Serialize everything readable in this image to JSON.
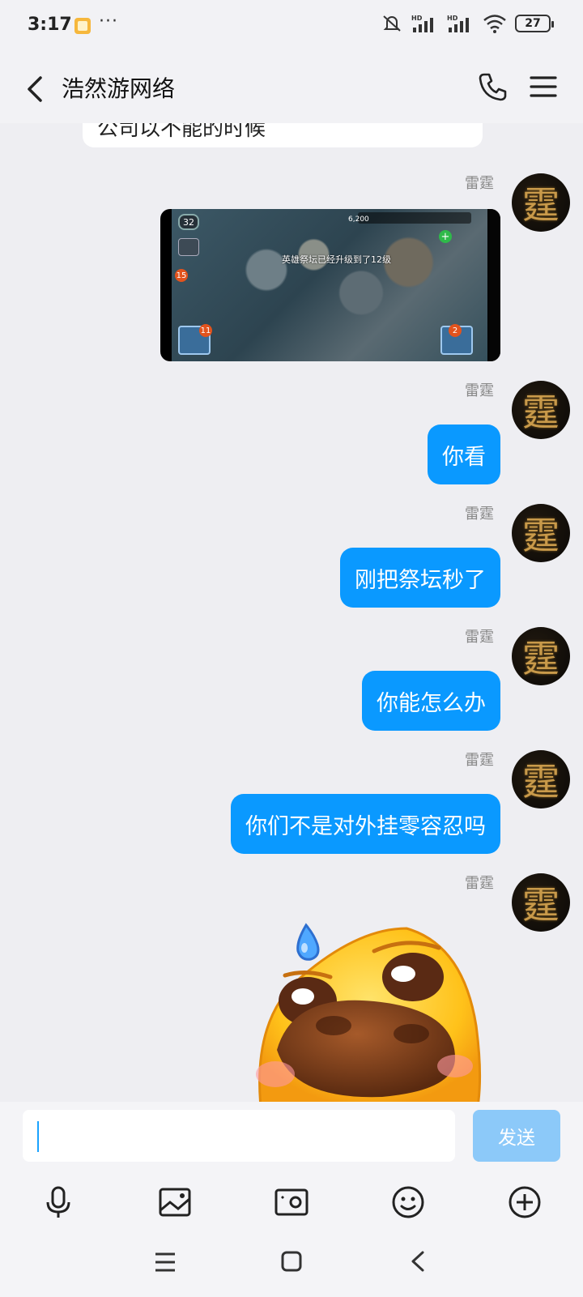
{
  "status": {
    "time": "3:17",
    "dots": "···",
    "battery": "27",
    "icons": [
      "app-notification-icon",
      "mute-icon",
      "hd-signal-icon",
      "hd-signal-icon",
      "wifi-icon",
      "battery-icon"
    ]
  },
  "header": {
    "title": "浩然游网络",
    "icons": [
      "back-arrow-icon",
      "phone-icon",
      "menu-icon"
    ]
  },
  "chat": {
    "previous_partial_text": "公司以不能的时候",
    "messages": [
      {
        "sender": "雷霆",
        "type": "image",
        "caption": "英雄祭坛已经升级到了12级"
      },
      {
        "sender": "雷霆",
        "type": "text",
        "text": "你看"
      },
      {
        "sender": "雷霆",
        "type": "text",
        "text": "刚把祭坛秒了"
      },
      {
        "sender": "雷霆",
        "type": "text",
        "text": "你能怎么办"
      },
      {
        "sender": "雷霆",
        "type": "text",
        "text": "你们不是对外挂零容忍吗"
      },
      {
        "sender": "雷霆",
        "type": "sticker",
        "sticker": "sweating-sad-dog-face"
      }
    ],
    "avatar_glyph": "霆"
  },
  "game_screenshot": {
    "level": "32",
    "badge_left": "15",
    "badge_shop": "11",
    "badge_battle": "2",
    "plus": "+",
    "resource": "6,200"
  },
  "composer": {
    "input_value": "",
    "send_label": "发送"
  },
  "toolbar": {
    "items": [
      "microphone-icon",
      "image-icon",
      "camera-icon",
      "emoji-icon",
      "plus-icon"
    ]
  },
  "system_nav": {
    "items": [
      "recent-apps-icon",
      "home-icon",
      "back-icon"
    ]
  },
  "colors": {
    "accent": "#0a99ff",
    "send_disabled": "#8cc9f9",
    "background": "#eeeef2"
  }
}
